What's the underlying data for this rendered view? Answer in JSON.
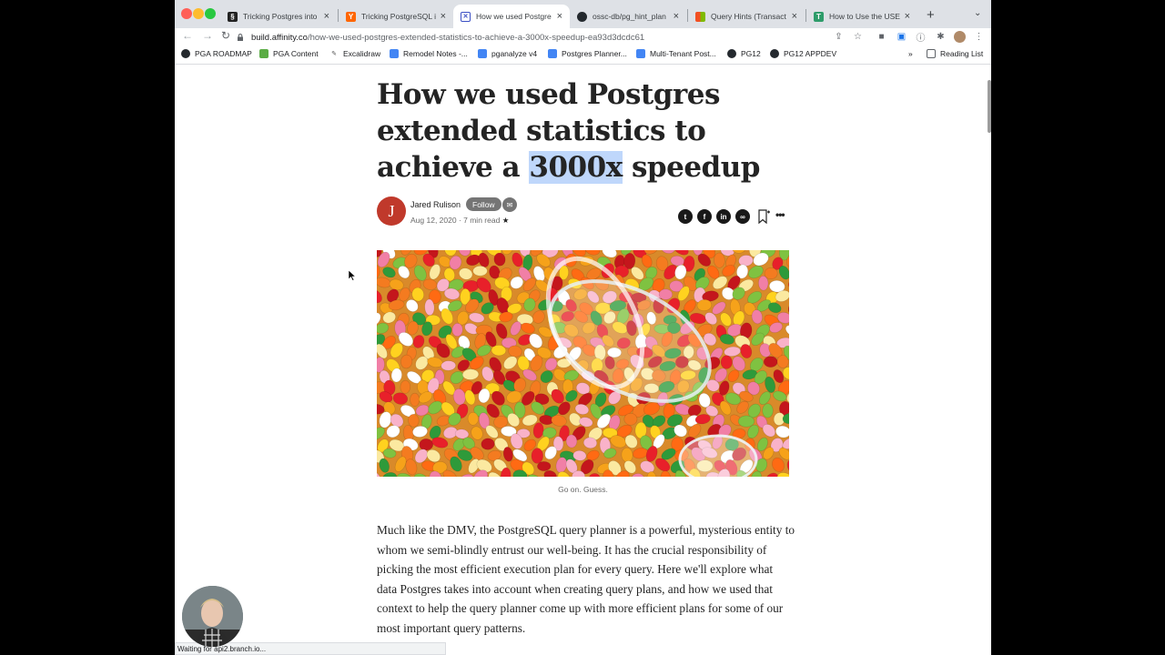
{
  "tabs": [
    {
      "title": "Tricking Postgres into",
      "icon": "squarespace-icon",
      "active": false
    },
    {
      "title": "Tricking PostgreSQL in",
      "icon": "hackernews-icon",
      "active": false
    },
    {
      "title": "How we used Postgre",
      "icon": "affinity-icon",
      "active": true
    },
    {
      "title": "ossc-db/pg_hint_plan",
      "icon": "github-icon",
      "active": false
    },
    {
      "title": "Query Hints (Transact",
      "icon": "microsoft-icon",
      "active": false
    },
    {
      "title": "How to Use the USE I",
      "icon": "tech-icon",
      "active": false
    }
  ],
  "address": {
    "host": "build.affinity.co",
    "path": "/how-we-used-postgres-extended-statistics-to-achieve-a-3000x-speedup-ea93d3dcdc61"
  },
  "bookmarks": [
    {
      "label": "PGA ROADMAP",
      "icon": "github-icon"
    },
    {
      "label": "PGA Content",
      "icon": "trello-icon"
    },
    {
      "label": "Excalidraw",
      "icon": "excalidraw-icon"
    },
    {
      "label": "Remodel Notes -...",
      "icon": "doc-icon"
    },
    {
      "label": "pganalyze v4",
      "icon": "doc-icon"
    },
    {
      "label": "Postgres Planner...",
      "icon": "doc-icon"
    },
    {
      "label": "Multi-Tenant Post...",
      "icon": "doc-icon"
    },
    {
      "label": "PG12",
      "icon": "github-icon"
    },
    {
      "label": "PG12 APPDEV",
      "icon": "github-icon"
    }
  ],
  "bookmarks_overflow": "»",
  "reading_list": "Reading List",
  "article": {
    "title_before": "How we used Postgres extended statistics to achieve a ",
    "title_highlight": "3000x",
    "title_after": " speedup",
    "author_initial": "J",
    "author": "Jared Rulison",
    "follow_label": "Follow",
    "date": "Aug 12, 2020",
    "read_time": "7 min read",
    "caption": "Go on. Guess.",
    "body": "Much like the DMV, the PostgreSQL query planner is a powerful, mysterious entity to whom we semi-blindly entrust our well-being. It has the crucial responsibility of picking the most efficient execution plan for every query. Here we'll explore what data Postgres takes into account when creating query plans, and how we used that context to help the query planner come up with more efficient plans for some of our most important query patterns."
  },
  "status": "Waiting for api2.branch.io..."
}
